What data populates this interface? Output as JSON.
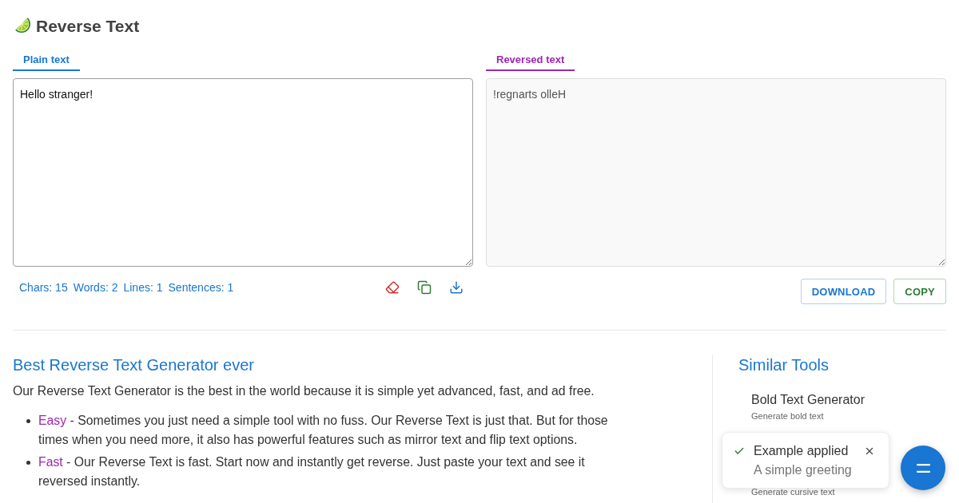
{
  "header": {
    "title": "Reverse Text"
  },
  "panels": [
    {
      "tab": {
        "label": "Plain text",
        "selected": true,
        "color": "#1976d2"
      },
      "text_field": {
        "value": "Hello stranger!",
        "read_only": false
      },
      "stats": [
        "Chars: 15",
        "Words: 2",
        "Lines: 1",
        "Sentences: 1"
      ]
    },
    {
      "tab": {
        "label": "Reversed text",
        "selected": true,
        "color": "#9c27b0"
      },
      "text_field": {
        "value": "!regnarts olleH",
        "read_only": true
      },
      "buttons": [
        {
          "label": "DOWNLOAD",
          "color": "#1976d2"
        },
        {
          "label": "COPY",
          "color": "#2e7d32"
        }
      ]
    }
  ],
  "article": {
    "heading": "Best Reverse Text Generator ever",
    "intro": "Our Reverse Text Generator is the best in the world because it is simple yet advanced, fast, and ad free.",
    "features": [
      {
        "term": "Easy",
        "parts": [
          {
            "kind": "text",
            "text": " - Sometimes you just need a simple tool with no fuss. Our Reverse Text is just that. But for those times when you need more, it also has powerful features such as mirror text and flip text options."
          }
        ]
      },
      {
        "term": "Fast",
        "parts": [
          {
            "kind": "text",
            "text": " - Our Reverse Text is fast. Start now and instantly get reverse. Just paste your text and see it reversed instantly."
          }
        ]
      }
    ]
  },
  "similar_tools": {
    "heading": "Similar Tools",
    "items": [
      {
        "title": "Bold Text Generator",
        "description": "Generate bold text"
      },
      {
        "description": "Generate cursive text"
      }
    ]
  },
  "toast": {
    "title": "Example applied",
    "message": "A simple greeting"
  }
}
